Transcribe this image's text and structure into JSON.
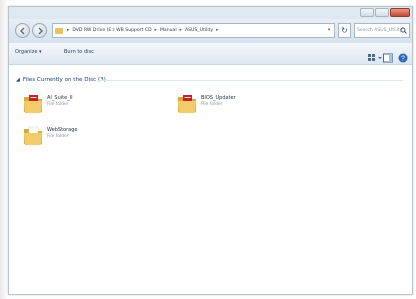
{
  "window": {
    "address": {
      "crumbs": [
        "DVD RW Drive (E:) WB Support CD",
        "Manual",
        "ASUS_Utility"
      ],
      "separator": "▸",
      "dropdown": "▾"
    },
    "refresh_glyph": "↻",
    "search_placeholder": "Search ASUS_Utility",
    "toolbar": {
      "organize_label": "Organize ▾",
      "burn_label": "Burn to disc"
    },
    "group": {
      "chevron": "◢",
      "title": "Files Currently on the Disc (3)"
    },
    "items": [
      {
        "name": "AI_Suite_II",
        "type": "File folder",
        "icon": "folder-with-document-icon"
      },
      {
        "name": "BIOS_Updater",
        "type": "File folder",
        "icon": "folder-with-document-icon"
      },
      {
        "name": "WebStorage",
        "type": "File folder",
        "icon": "folder-icon"
      }
    ]
  },
  "colors": {
    "chrome": "#d6e2ee",
    "folder": "#e9c35a",
    "folder_accent": "#c8202a",
    "link_blue": "#1e3a8a"
  }
}
